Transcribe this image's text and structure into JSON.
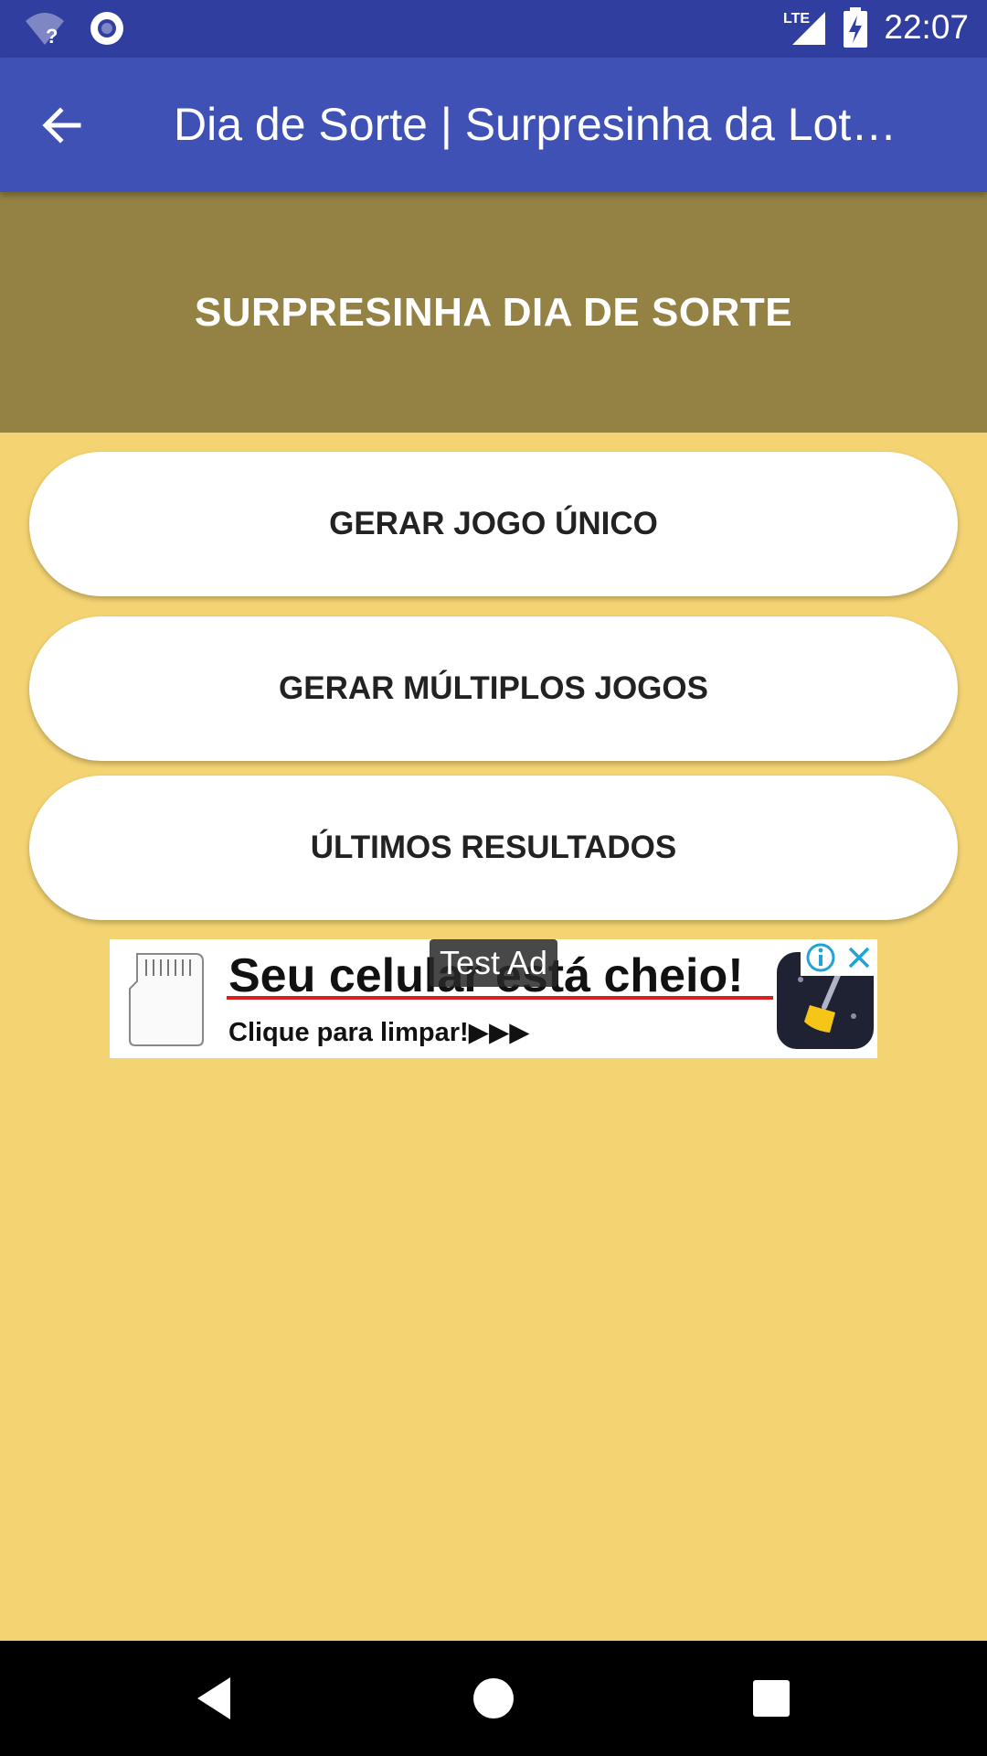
{
  "status_bar": {
    "time": "22:07",
    "network_label": "LTE",
    "icons": [
      "wifi-unknown-icon",
      "sync-circle-icon",
      "lte-signal-icon",
      "battery-charging-icon"
    ]
  },
  "app_bar": {
    "title": "Dia de Sorte | Surpresinha da Lot…",
    "back_icon": "arrow-back-icon"
  },
  "header": {
    "title": "SURPRESINHA DIA DE SORTE"
  },
  "buttons": [
    {
      "label": "GERAR JOGO ÚNICO"
    },
    {
      "label": "GERAR MÚLTIPLOS JOGOS"
    },
    {
      "label": "ÚLTIMOS RESULTADOS"
    }
  ],
  "ad": {
    "badge": "Test Ad",
    "headline": "Seu celular está cheio!",
    "subline": "Clique para limpar!▶▶▶"
  },
  "nav_bar": {
    "icons": [
      "nav-back-icon",
      "nav-home-icon",
      "nav-recents-icon"
    ]
  },
  "colors": {
    "status_bar": "#303f9f",
    "app_bar": "#3f51b5",
    "header_band": "#948244",
    "background": "#f3d372",
    "ad_underline": "#d81e1e"
  }
}
